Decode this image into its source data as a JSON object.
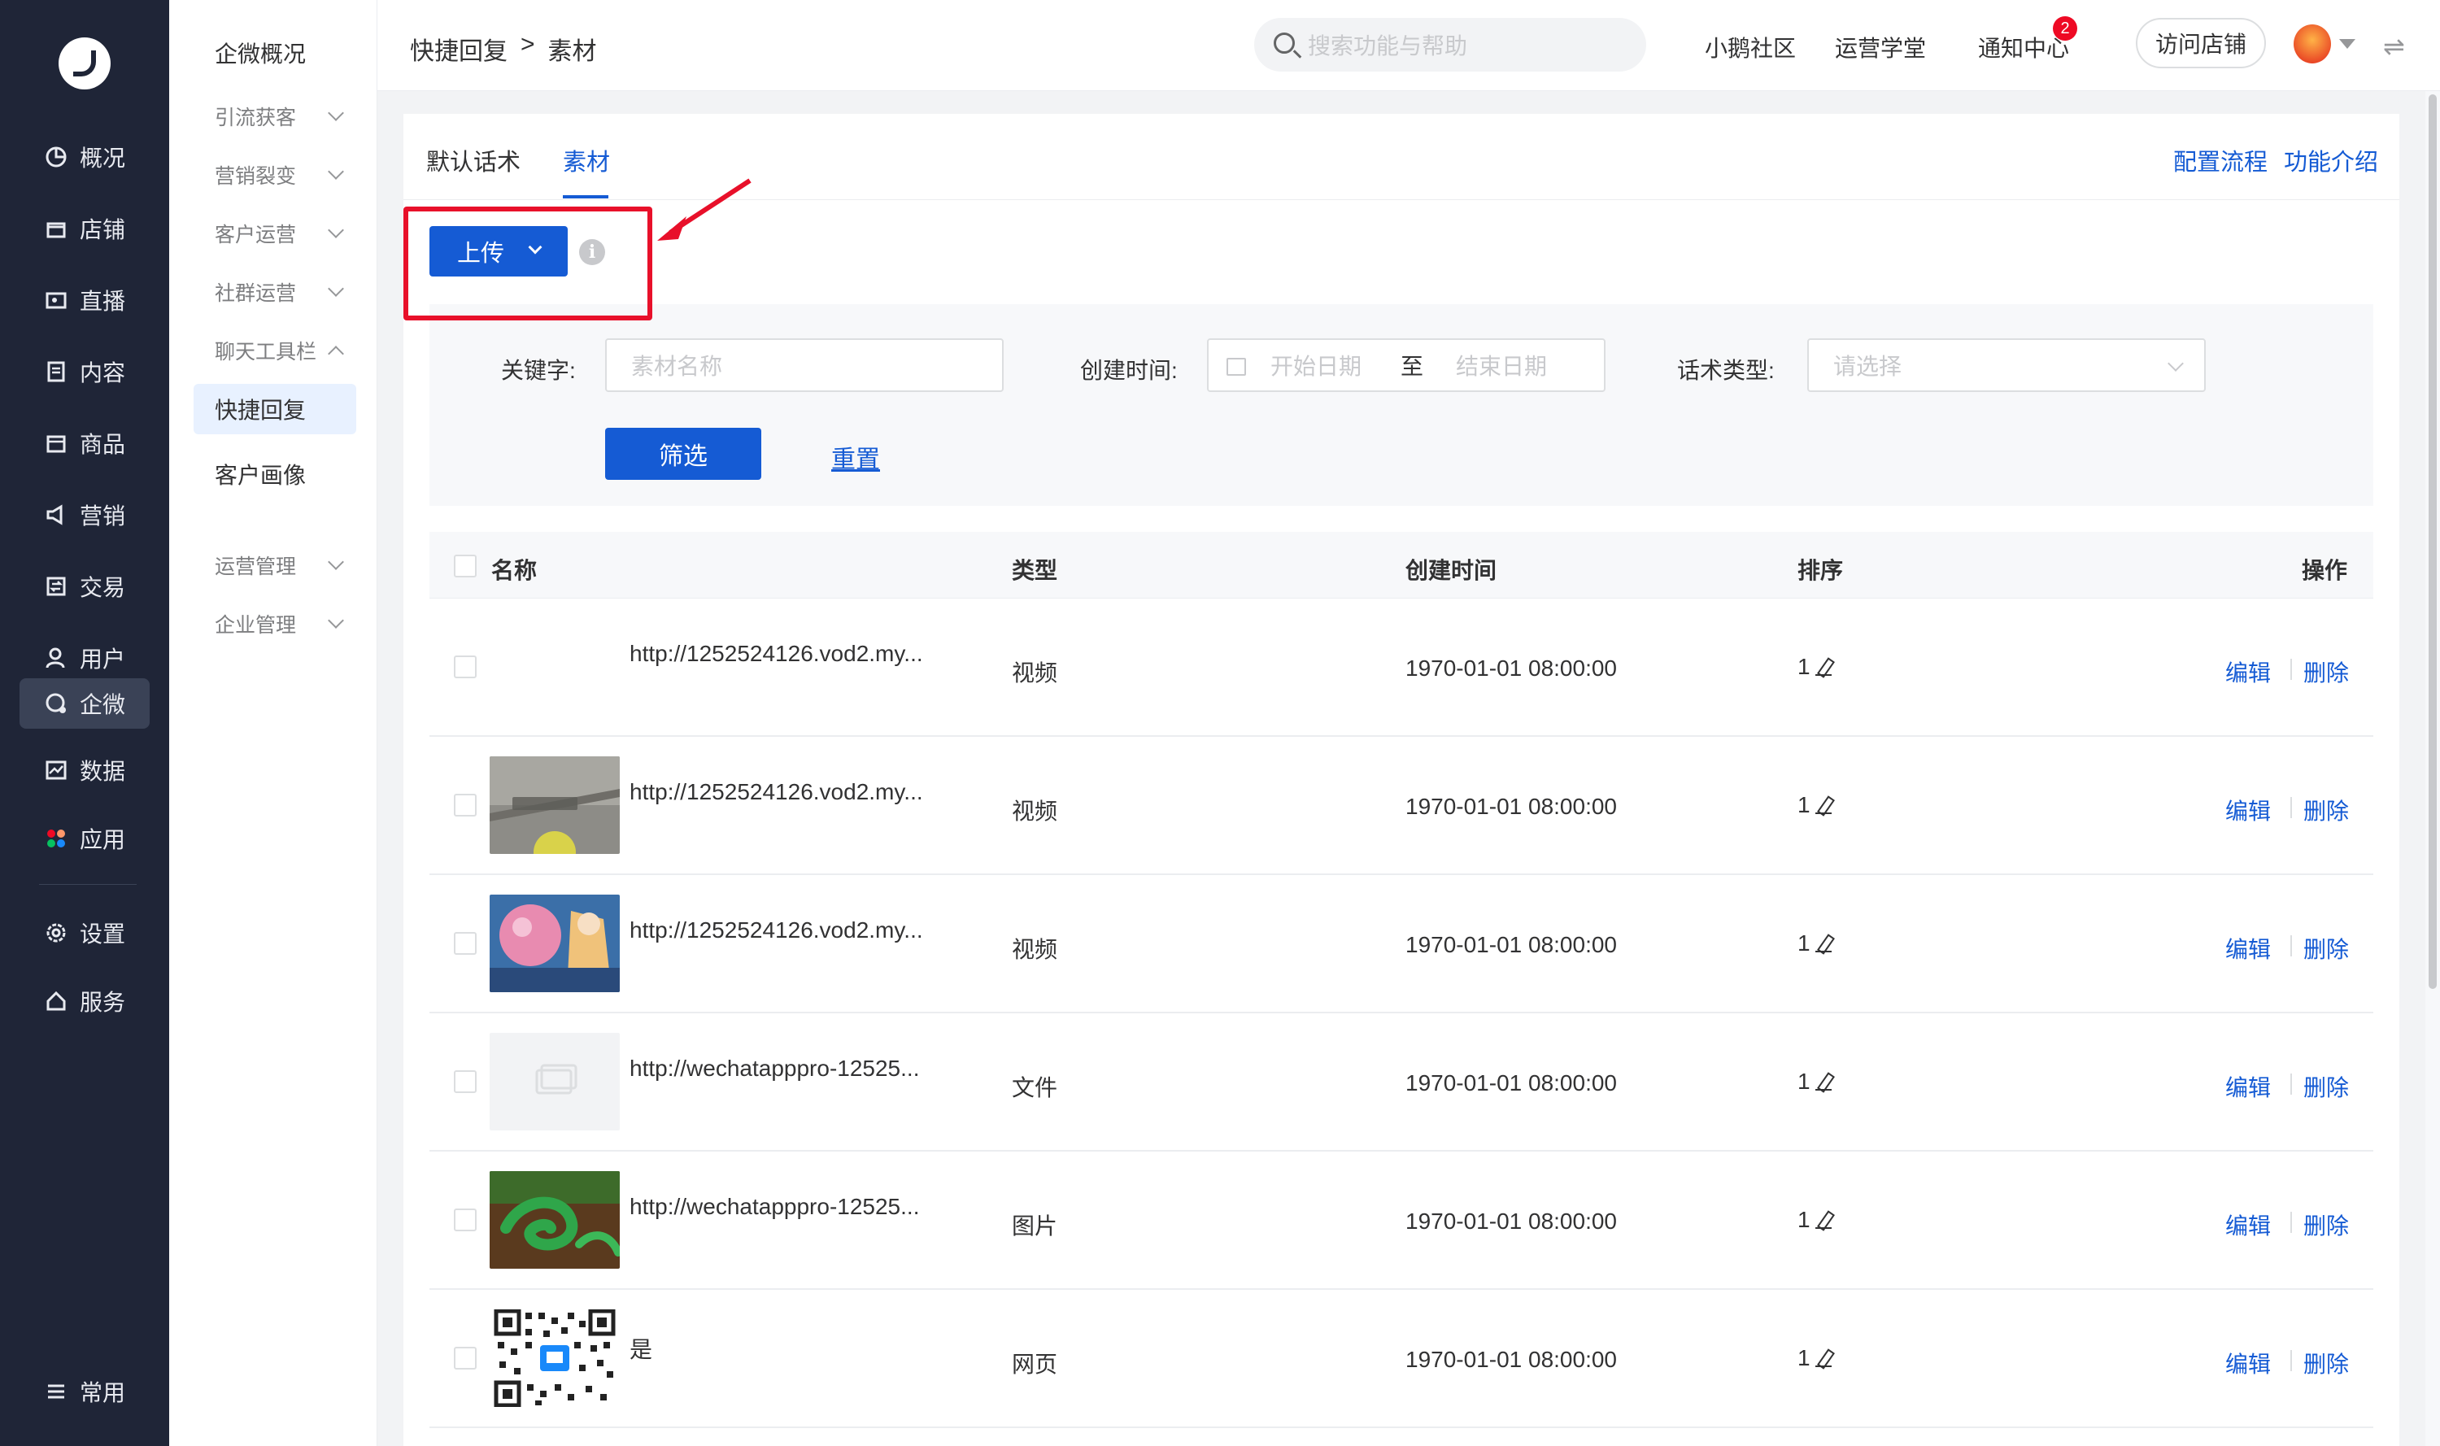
{
  "nav": {
    "items": [
      {
        "label": "概况",
        "icon": "overview-icon"
      },
      {
        "label": "店铺",
        "icon": "store-icon"
      },
      {
        "label": "直播",
        "icon": "live-icon"
      },
      {
        "label": "内容",
        "icon": "content-icon"
      },
      {
        "label": "商品",
        "icon": "goods-icon"
      },
      {
        "label": "营销",
        "icon": "marketing-icon"
      },
      {
        "label": "交易",
        "icon": "trade-icon"
      },
      {
        "label": "用户",
        "icon": "user-icon"
      },
      {
        "label": "企微",
        "icon": "wecom-icon"
      },
      {
        "label": "数据",
        "icon": "data-icon"
      },
      {
        "label": "应用",
        "icon": "apps-icon"
      },
      {
        "label": "设置",
        "icon": "settings-icon"
      },
      {
        "label": "服务",
        "icon": "service-icon"
      },
      {
        "label": "常用",
        "icon": "menu-icon"
      }
    ]
  },
  "subnav": {
    "items": [
      {
        "label": "企微概况"
      },
      {
        "label": "引流获客"
      },
      {
        "label": "营销裂变"
      },
      {
        "label": "客户运营"
      },
      {
        "label": "社群运营"
      },
      {
        "label": "聊天工具栏"
      },
      {
        "label": "快捷回复"
      },
      {
        "label": "客户画像"
      },
      {
        "label": "运营管理"
      },
      {
        "label": "企业管理"
      }
    ]
  },
  "header": {
    "breadcrumb": [
      "快捷回复",
      ">",
      "素材"
    ],
    "search_placeholder": "搜索功能与帮助",
    "links": [
      "小鹅社区",
      "运营学堂",
      "通知中心"
    ],
    "notification_count": "2",
    "visit_store": "访问店铺",
    "swap_glyph": "⇌"
  },
  "tabs": [
    "默认话术",
    "素材"
  ],
  "head_links": [
    "配置流程",
    "功能介绍"
  ],
  "upload": {
    "label": "上传",
    "info_glyph": "i"
  },
  "filter": {
    "keyword_label": "关键字:",
    "keyword_placeholder": "素材名称",
    "date_label": "创建时间:",
    "date_start": "开始日期",
    "date_sep": "至",
    "date_end": "结束日期",
    "type_label": "话术类型:",
    "type_placeholder": "请选择",
    "filter_button": "筛选",
    "reset_link": "重置"
  },
  "table": {
    "columns": [
      "名称",
      "类型",
      "创建时间",
      "排序",
      "操作"
    ],
    "rows": [
      {
        "thumb": "none",
        "name": "http://1252524126.vod2.my...",
        "type": "视频",
        "time": "1970-01-01 08:00:00",
        "sort": "1"
      },
      {
        "thumb": "floor",
        "name": "http://1252524126.vod2.my...",
        "type": "视频",
        "time": "1970-01-01 08:00:00",
        "sort": "1"
      },
      {
        "thumb": "anime",
        "name": "http://1252524126.vod2.my...",
        "type": "视频",
        "time": "1970-01-01 08:00:00",
        "sort": "1"
      },
      {
        "thumb": "file",
        "name": "http://wechatapppro-12525...",
        "type": "文件",
        "time": "1970-01-01 08:00:00",
        "sort": "1"
      },
      {
        "thumb": "snake",
        "name": "http://wechatapppro-12525...",
        "type": "图片",
        "time": "1970-01-01 08:00:00",
        "sort": "1"
      },
      {
        "thumb": "qrcode",
        "name": "是",
        "type": "网页",
        "time": "1970-01-01 08:00:00",
        "sort": "1"
      }
    ],
    "edit_label": "编辑",
    "delete_label": "删除"
  },
  "colors": {
    "accent": "#155bd4",
    "nav_bg": "#1f2537",
    "annotation": "#e8102a"
  }
}
